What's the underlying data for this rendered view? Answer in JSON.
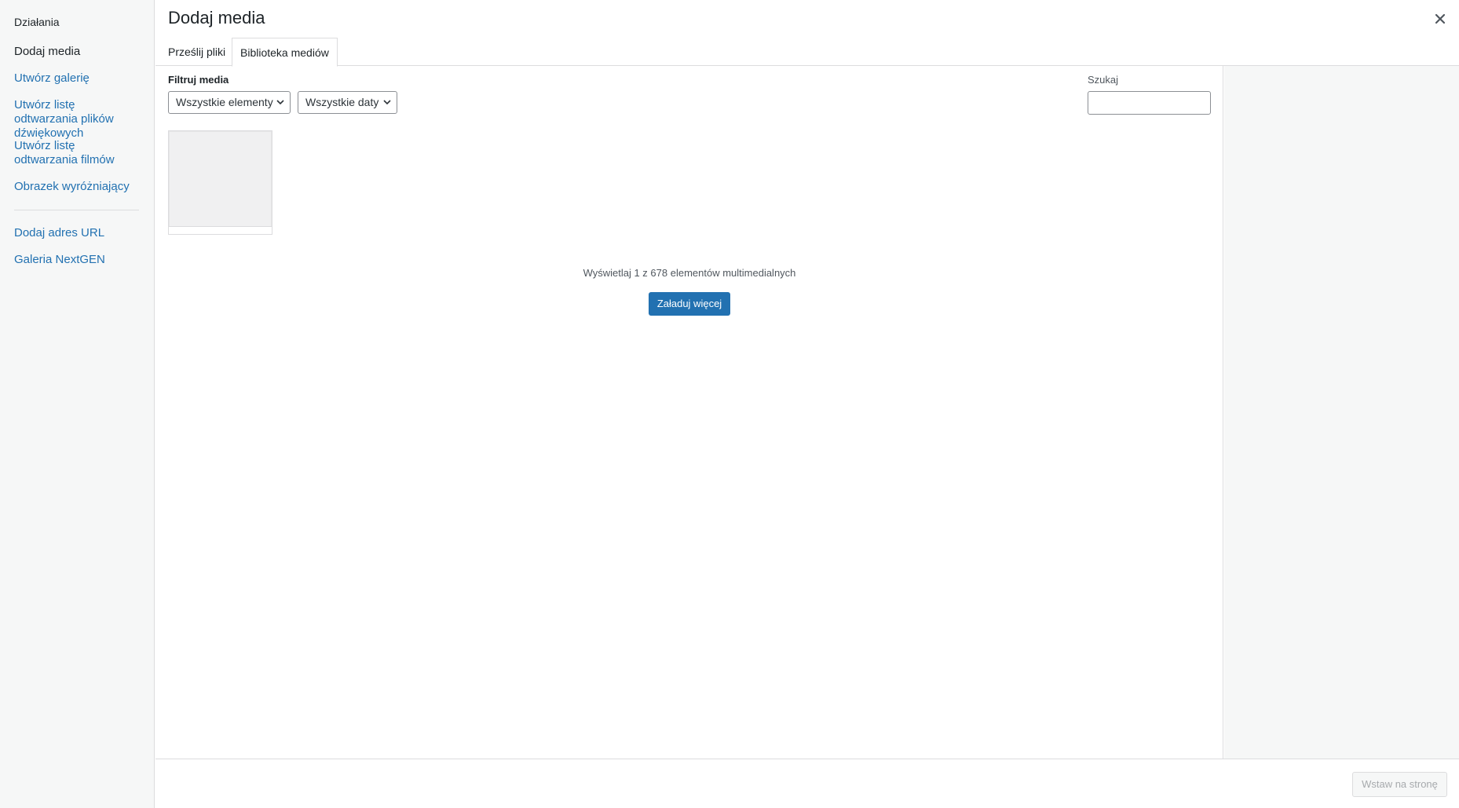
{
  "sidebar": {
    "heading": "Działania",
    "items": [
      {
        "label": "Dodaj media",
        "active": true
      },
      {
        "label": "Utwórz galerię"
      },
      {
        "label": "Utwórz listę odtwarzania plików dźwiękowych"
      },
      {
        "label": "Utwórz listę odtwarzania filmów"
      },
      {
        "label": "Obrazek wyróżniający"
      },
      {
        "label": "Dodaj adres URL"
      },
      {
        "label": "Galeria NextGEN"
      }
    ]
  },
  "header": {
    "title": "Dodaj media",
    "close_icon": "close-icon"
  },
  "tabs": [
    {
      "label": "Prześlij pliki"
    },
    {
      "label": "Biblioteka mediów",
      "active": true
    }
  ],
  "filters": {
    "label": "Filtruj media",
    "type_select": "Wszystkie elementy",
    "date_select": "Wszystkie daty"
  },
  "search": {
    "label": "Szukaj",
    "value": ""
  },
  "library": {
    "count_text": "Wyświetlaj 1 z 678 elementów multimedialnych",
    "load_more": "Załaduj więcej"
  },
  "footer": {
    "insert_button": "Wstaw na stronę"
  },
  "colors": {
    "accent": "#2271b1",
    "sidebar_bg": "#f6f7f7",
    "border": "#dcdcde"
  }
}
